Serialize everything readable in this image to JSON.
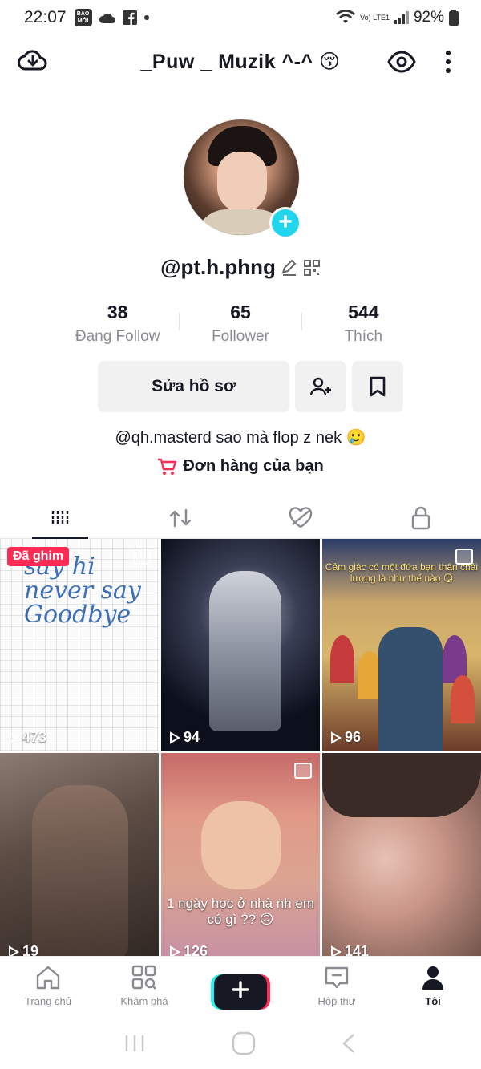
{
  "status_bar": {
    "time": "22:07",
    "badge_text": "BÁO MỚI",
    "network": "Vo) LTE1",
    "battery": "92%"
  },
  "header": {
    "title": "_Puw _ Muzik ^-^ 😚"
  },
  "profile": {
    "username": "@pt.h.phng"
  },
  "stats": [
    {
      "value": "38",
      "label": "Đang Follow"
    },
    {
      "value": "65",
      "label": "Follower"
    },
    {
      "value": "544",
      "label": "Thích"
    }
  ],
  "actions": {
    "edit_label": "Sửa hồ sơ"
  },
  "bio": "@qh.masterd  sao mà flop z nek 🥲",
  "orders": {
    "label": "Đơn hàng của bạn"
  },
  "videos": [
    {
      "views": "473",
      "pinned_label": "Đã ghim",
      "handwriting": "say hi never say Goodbye"
    },
    {
      "views": "94"
    },
    {
      "views": "96",
      "caption": "Cảm giác có một đứa bạn thân chải lượng là như thế nào 😏"
    },
    {
      "views": "19"
    },
    {
      "views": "126",
      "caption": "1 ngày học ở nhà nh em có gì ?? 🙃"
    },
    {
      "views": "141"
    }
  ],
  "bottom_nav": [
    {
      "label": "Trang chủ"
    },
    {
      "label": "Khám phá"
    },
    {
      "label": "Hộp thư"
    },
    {
      "label": "Tôi"
    }
  ],
  "colors": {
    "accent": "#fe2c55",
    "cyan": "#20d5ec",
    "text": "#161823",
    "muted": "#8a8b91"
  }
}
